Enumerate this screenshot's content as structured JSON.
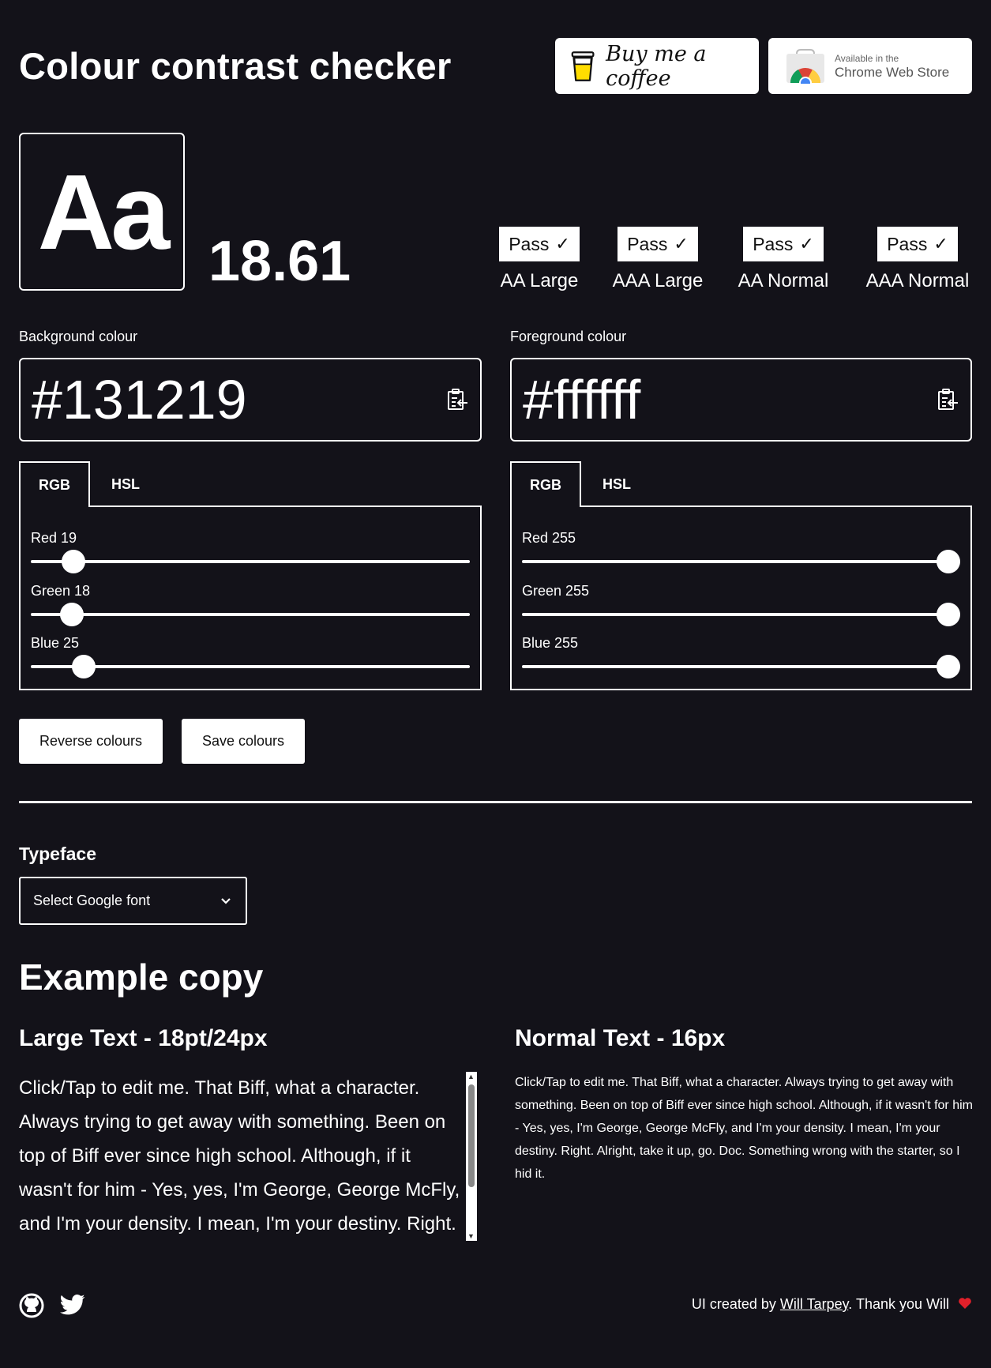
{
  "header": {
    "title": "Colour contrast checker",
    "coffee_label": "Buy me a coffee",
    "chrome_small": "Available in the",
    "chrome_big": "Chrome Web Store"
  },
  "preview": {
    "sample": "Aa",
    "ratio": "18.61"
  },
  "results": [
    {
      "badge": "Pass",
      "label": "AA Large"
    },
    {
      "badge": "Pass",
      "label": "AAA Large"
    },
    {
      "badge": "Pass",
      "label": "AA Normal"
    },
    {
      "badge": "Pass",
      "label": "AAA Normal"
    }
  ],
  "background": {
    "label": "Background colour",
    "hex": "#131219",
    "tabs": [
      "RGB",
      "HSL"
    ],
    "active_tab": "RGB",
    "sliders": [
      {
        "label": "Red 19",
        "value": 19,
        "max": 255
      },
      {
        "label": "Green 18",
        "value": 18,
        "max": 255
      },
      {
        "label": "Blue 25",
        "value": 25,
        "max": 255
      }
    ]
  },
  "foreground": {
    "label": "Foreground colour",
    "hex": "#ffffff",
    "tabs": [
      "RGB",
      "HSL"
    ],
    "active_tab": "RGB",
    "sliders": [
      {
        "label": "Red 255",
        "value": 255,
        "max": 255
      },
      {
        "label": "Green 255",
        "value": 255,
        "max": 255
      },
      {
        "label": "Blue 255",
        "value": 255,
        "max": 255
      }
    ]
  },
  "actions": {
    "reverse": "Reverse colours",
    "save": "Save colours"
  },
  "typeface": {
    "heading": "Typeface",
    "select_value": "Select Google font"
  },
  "example": {
    "heading": "Example copy",
    "large_heading": "Large Text - 18pt/24px",
    "normal_heading": "Normal Text - 16px",
    "large_copy": "Click/Tap to edit me. That Biff, what a character. Always trying to get away with something. Been on top of Biff ever since high school. Although, if it wasn't for him - Yes, yes, I'm George, George McFly, and I'm your density. I mean, I'm your destiny. Right.",
    "normal_copy": "Click/Tap to edit me. That Biff, what a character. Always trying to get away with something. Been on top of Biff ever since high school. Although, if it wasn't for him - Yes, yes, I'm George, George McFly, and I'm your density. I mean, I'm your destiny. Right. Alright, take it up, go. Doc. Something wrong with the starter, so I hid it."
  },
  "footer": {
    "credit_prefix": "UI created by ",
    "credit_link": "Will Tarpey",
    "credit_suffix": ". Thank you Will"
  },
  "colors": {
    "background": "#131219",
    "foreground": "#ffffff",
    "heart": "#e0202a"
  }
}
